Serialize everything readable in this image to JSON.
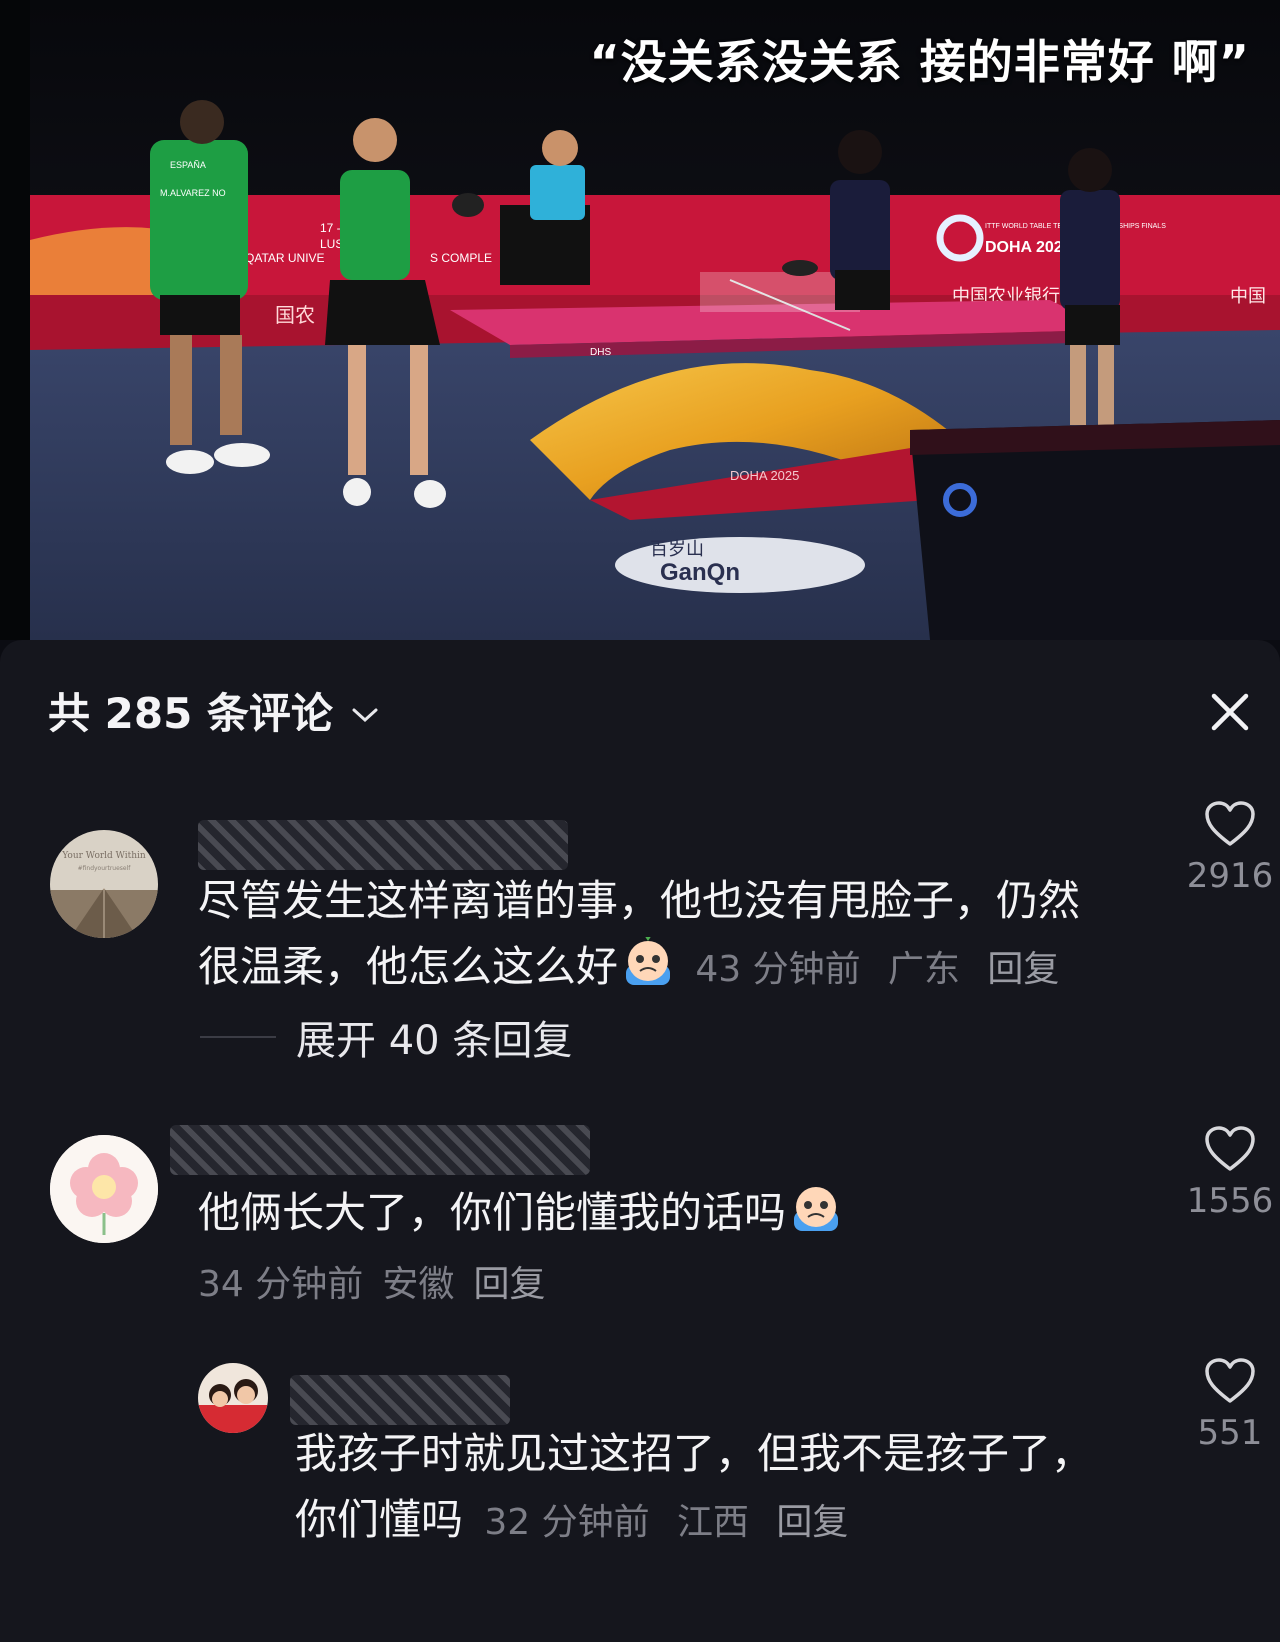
{
  "video": {
    "caption": "“没关系没关系 接的非常好 啊”",
    "scene_text": {
      "event_date": "17 -",
      "venue_a": "LUS",
      "venue_b": "QATAR UNIVE",
      "venue_c": "S COMPLE",
      "brand_left": "国农",
      "brand_right": "中国农业银行",
      "brand_far": "中国",
      "wttc_small": "ITTF WORLD TABLE TENNIS CHAMPIONSHIPS FINALS",
      "wttc_big": "DOHA 2025",
      "table_brand": "DHS",
      "table_doha": "DOHA 2025",
      "floor_logo_top": "百岁山",
      "floor_logo_bottom": "GanQn",
      "player_shirt_a": "ESPAÑA",
      "player_shirt_b": "M.ALVAREZ NO"
    }
  },
  "sheet": {
    "title": "共 285 条评论",
    "comments": [
      {
        "username_label": "已隐藏",
        "text_line1": "尽管发生这样离谱的事，他也没有甩脸子，仍然",
        "text_line2": "很温柔，他怎么这么好",
        "time": "43 分钟前",
        "location": "广东",
        "reply": "回复",
        "likes": "2916",
        "expand": "展开 40 条回复",
        "avatar_text_1": "Your World Within",
        "avatar_text_2": "#findyourtrueself"
      },
      {
        "username_label": "Mountain",
        "text_line1": "他俩长大了，你们能懂我的话吗",
        "time": "34 分钟前",
        "location": "安徽",
        "reply": "回复",
        "likes": "1556"
      },
      {
        "username_label": "已隐藏",
        "text_line1": "我孩子时就见过这招了，但我不是孩子了，",
        "text_line2": "你们懂吗",
        "time": "32 分钟前",
        "location": "江西",
        "reply": "回复",
        "likes": "551"
      }
    ]
  },
  "colors": {
    "background": "#15161d",
    "text": "#f4f4f6",
    "meta": "#7d7e87",
    "banner_red": "#c8163a",
    "table_pink": "#d9336f",
    "court_blue": "#2d3a5c"
  },
  "icons": {
    "expand": "chevron-down-icon",
    "close": "close-icon",
    "like": "heart-outline-icon",
    "emoji": "crying-face-emoji"
  }
}
